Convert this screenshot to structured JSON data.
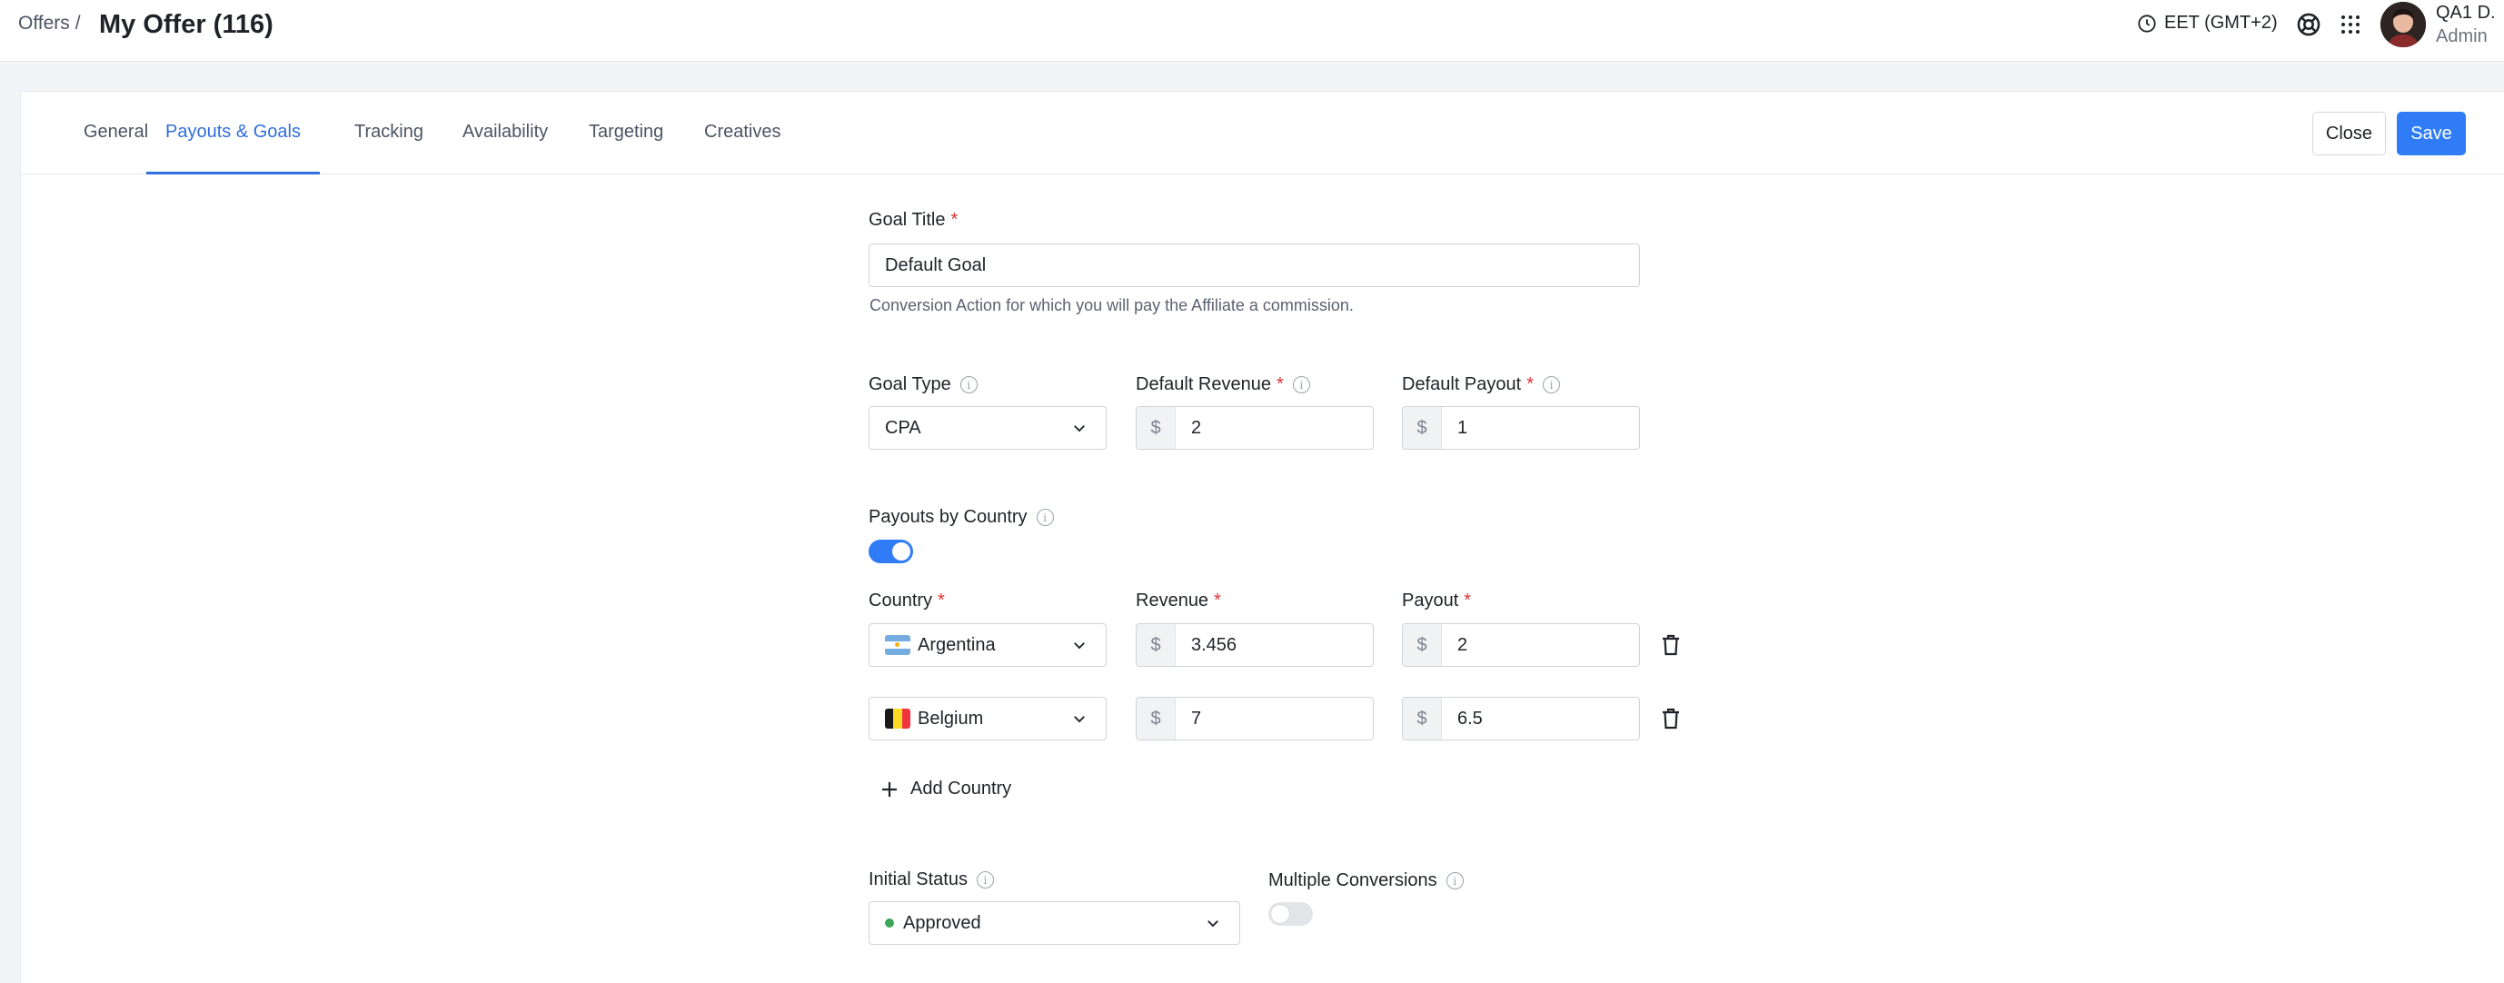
{
  "breadcrumb": {
    "parent": "Offers",
    "separator": "/"
  },
  "page_title": "My Offer (116)",
  "header": {
    "timezone": "EET (GMT+2)",
    "user_name": "QA1 D.",
    "user_role": "Admin",
    "icons": [
      "clock-icon",
      "help-lifebuoy-icon",
      "apps-grid-icon"
    ]
  },
  "tabs": [
    {
      "label": "General",
      "active": false
    },
    {
      "label": "Payouts & Goals",
      "active": true
    },
    {
      "label": "Tracking",
      "active": false
    },
    {
      "label": "Availability",
      "active": false
    },
    {
      "label": "Targeting",
      "active": false
    },
    {
      "label": "Creatives",
      "active": false
    }
  ],
  "actions": {
    "close_label": "Close",
    "save_label": "Save"
  },
  "form": {
    "goal_title": {
      "label": "Goal Title",
      "value": "Default Goal",
      "hint": "Conversion Action for which you will pay the Affiliate a commission."
    },
    "goal_type": {
      "label": "Goal Type",
      "value": "CPA"
    },
    "default_revenue": {
      "label": "Default Revenue",
      "currency": "$",
      "value": "2"
    },
    "default_payout": {
      "label": "Default Payout",
      "currency": "$",
      "value": "1"
    },
    "payouts_by_country": {
      "label": "Payouts by Country",
      "enabled": true
    },
    "country_columns": {
      "country": "Country",
      "revenue": "Revenue",
      "payout": "Payout"
    },
    "country_rows": [
      {
        "country": "Argentina",
        "revenue": "3.456",
        "payout": "2",
        "currency": "$"
      },
      {
        "country": "Belgium",
        "revenue": "7",
        "payout": "6.5",
        "currency": "$"
      }
    ],
    "add_country_label": "Add Country",
    "initial_status": {
      "label": "Initial Status",
      "value": "Approved",
      "status_color": "#3aa657"
    },
    "multiple_conversions": {
      "label": "Multiple Conversions",
      "enabled": false
    }
  },
  "colors": {
    "accent": "#2f7cf6",
    "required": "#e03131"
  }
}
